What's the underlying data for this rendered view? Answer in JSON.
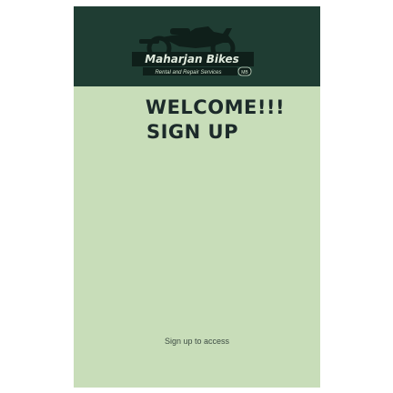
{
  "header": {
    "logo": {
      "icon": "motorcycle-icon",
      "brand_name": "Maharjan Bikes",
      "tagline": "Rental and Repair Services",
      "badge": "MB"
    }
  },
  "main": {
    "welcome_line1": "WELCOME!!!",
    "welcome_line2": "SIGN UP",
    "footer_text": "Sign up to access"
  },
  "colors": {
    "header_bg": "#1f3d33",
    "body_bg": "#c8ddb9",
    "text_dark": "#1c2a2a"
  }
}
